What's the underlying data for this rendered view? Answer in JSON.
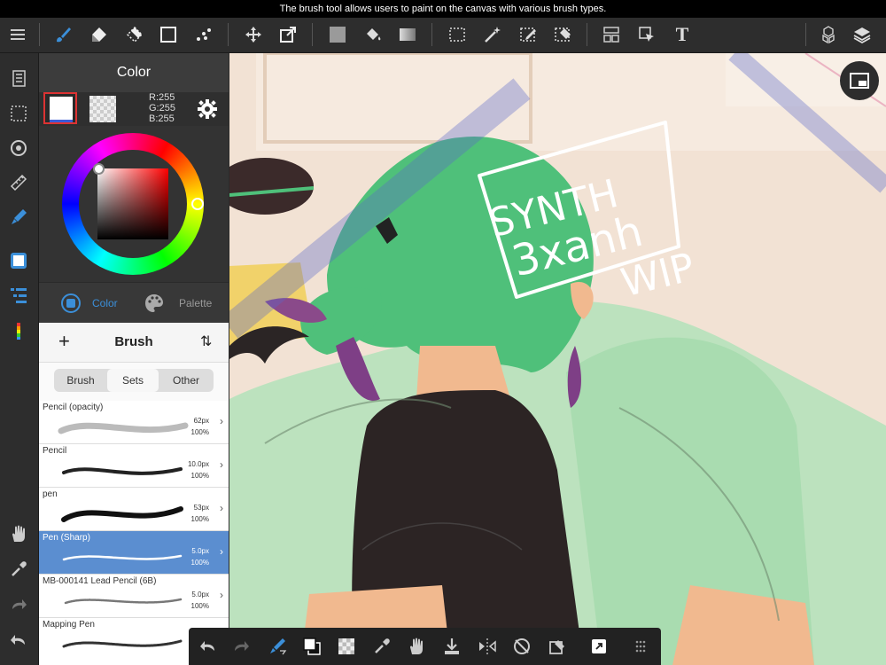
{
  "tooltip": "The brush tool allows users to paint on the canvas with various brush types.",
  "colors": {
    "accent": "#3b8fd9",
    "selected_row": "#5b8ed0",
    "toolbar_bg": "#2d2d2d",
    "hair_green": "#4fc07a"
  },
  "toolbar": {
    "icons": [
      "menu-icon",
      "brush-icon",
      "eraser-icon",
      "blur-eraser-icon",
      "shape-icon",
      "dot-brush-icon",
      "move-icon",
      "transform-icon",
      "fill-color-icon",
      "bucket-icon",
      "gradient-icon",
      "select-rect-icon",
      "magic-wand-icon",
      "select-pen-icon",
      "select-eraser-icon",
      "layout-icon",
      "selection-cursor-icon",
      "text-icon",
      "3d-material-icon",
      "layers-icon"
    ],
    "text_tool_label": "T"
  },
  "rail": {
    "icons": [
      "pages-icon",
      "selection-icon",
      "snap-icon",
      "ruler-icon",
      "fill-brush-icon",
      "color-swatch-icon",
      "list-icon",
      "brush-palette-icon",
      "hand-icon",
      "eyedropper-icon",
      "redo-icon",
      "undo-icon"
    ]
  },
  "color_panel": {
    "title": "Color",
    "rgb": {
      "r": "R:255",
      "g": "G:255",
      "b": "B:255"
    },
    "tabs": [
      {
        "label": "Color",
        "icon": "color-tab-icon",
        "active": true
      },
      {
        "label": "Palette",
        "icon": "palette-icon",
        "active": false
      }
    ]
  },
  "brush_panel": {
    "title": "Brush",
    "add_icon": "+",
    "sort_icon": "⇅",
    "segments": [
      "Brush",
      "Sets",
      "Other"
    ],
    "active_segment": "Sets",
    "brushes": [
      {
        "name": "Pencil (opacity)",
        "size": "62px",
        "opacity": "100%",
        "selected": false
      },
      {
        "name": "Pencil",
        "size": "10.0px",
        "opacity": "100%",
        "selected": false
      },
      {
        "name": "pen",
        "size": "53px",
        "opacity": "100%",
        "selected": false
      },
      {
        "name": "Pen (Sharp)",
        "size": "5.0px",
        "opacity": "100%",
        "selected": true
      },
      {
        "name": "MB-000141 Lead Pencil (6B)",
        "size": "5.0px",
        "opacity": "100%",
        "selected": false
      },
      {
        "name": "Mapping Pen",
        "size": "",
        "opacity": "",
        "selected": false
      }
    ]
  },
  "canvas": {
    "handwriting_line1": "SYNTH",
    "handwriting_line2": "3xanh",
    "handwriting_line3": "WIP"
  },
  "bottom_bar": {
    "icons": [
      "undo-icon",
      "redo-icon",
      "quick-brush-icon",
      "color-swap-icon",
      "transparent-icon",
      "eyedropper-icon",
      "hand-icon",
      "save-icon",
      "flip-icon",
      "rotate-reset-icon",
      "quick-select-icon",
      "fullscreen-icon",
      "more-icon"
    ]
  }
}
